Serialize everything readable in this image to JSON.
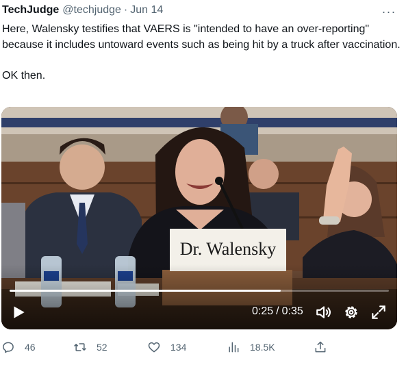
{
  "tweet": {
    "name": "TechJudge",
    "handle": "@techjudge",
    "separator": "·",
    "date": "Jun 14",
    "more_icon": "···",
    "paragraphs": [
      "Here, Walensky testifies that VAERS is \"intended to have an over-reporting\" because it includes untoward events such as being hit by a truck after vaccination.",
      "OK then."
    ]
  },
  "video": {
    "placard_text": "Dr. Walensky",
    "current_time": "0:25",
    "time_separator": "/",
    "duration": "0:35",
    "progress_fraction": 0.714,
    "icons": [
      "play-icon",
      "volume-icon",
      "settings-gear-icon",
      "fullscreen-icon"
    ]
  },
  "actions": {
    "replies": "46",
    "retweets": "52",
    "likes": "134",
    "views": "18.5K"
  },
  "colors": {
    "text": "#0f1419",
    "secondary": "#536471",
    "background": "#ffffff"
  }
}
